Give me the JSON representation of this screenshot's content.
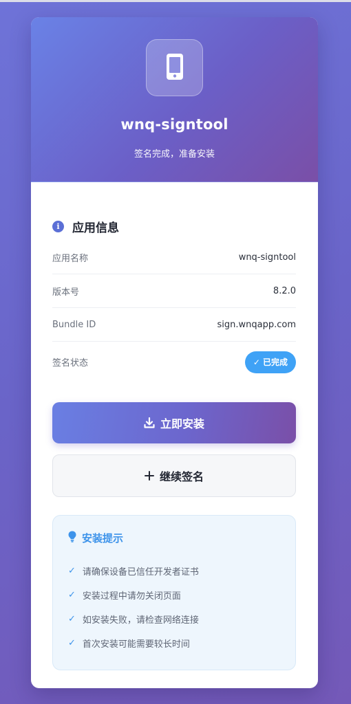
{
  "hero": {
    "app_name": "wnq-signtool",
    "subtitle": "签名完成，准备安装",
    "icon": "smartphone-icon"
  },
  "app_info": {
    "section_title": "应用信息",
    "section_icon": "info-icon",
    "rows": [
      {
        "label": "应用名称",
        "value": "wnq-signtool"
      },
      {
        "label": "版本号",
        "value": "8.2.0"
      },
      {
        "label": "Bundle ID",
        "value": "sign.wnqapp.com"
      }
    ],
    "status_label": "签名状态",
    "status_badge": "已完成",
    "status_color": "#3fa2f6"
  },
  "actions": {
    "install_label": "立即安装",
    "install_icon": "download-icon",
    "continue_label": "继续签名",
    "continue_icon": "plus-icon"
  },
  "tips": {
    "title": "安装提示",
    "icon": "lightbulb-icon",
    "items": [
      "请确保设备已信任开发者证书",
      "安装过程中请勿关闭页面",
      "如安装失败，请检查网络连接",
      "首次安装可能需要较长时间"
    ]
  },
  "colors": {
    "accent": "#6b6fd6",
    "tip_accent": "#3d93ea"
  }
}
